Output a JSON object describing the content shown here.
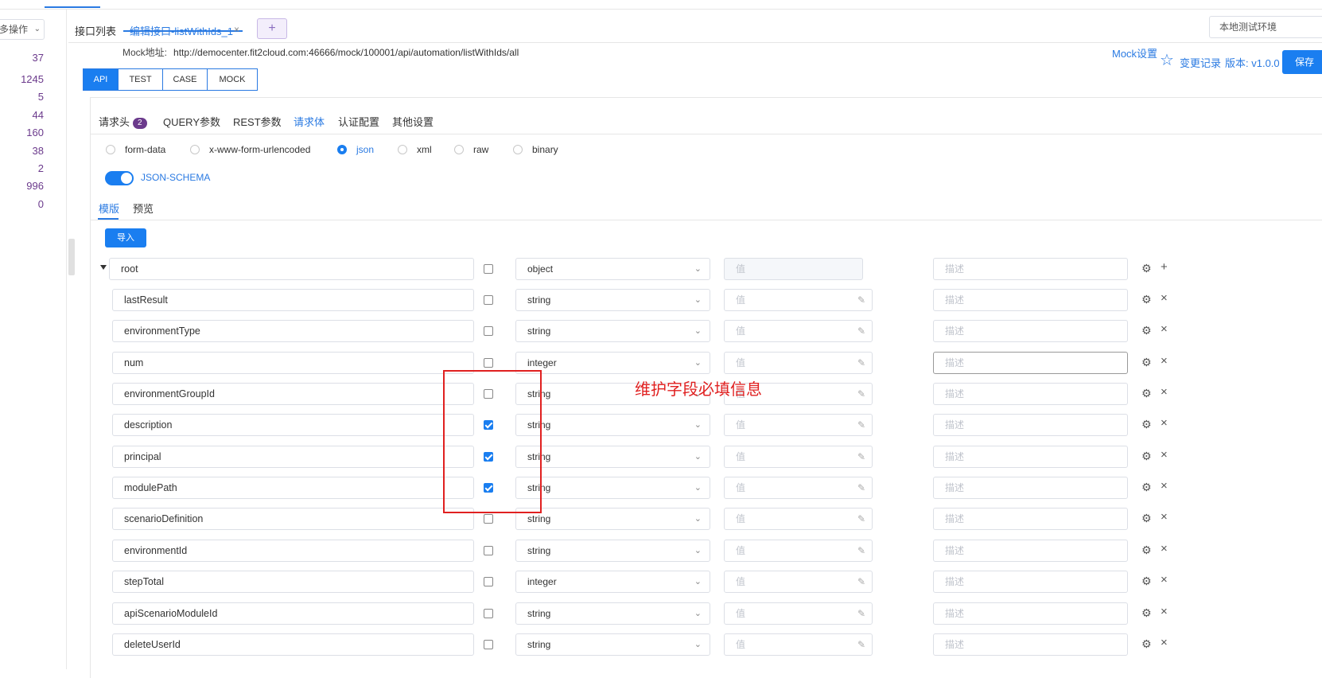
{
  "left_panel": {
    "more_ops_label": "多操作",
    "counts": [
      "37",
      "1245",
      "5",
      "44",
      "160",
      "38",
      "2",
      "996",
      "0"
    ]
  },
  "tabs": {
    "list_tab": "接口列表",
    "edit_tab": "编辑接口-listWithIds_1",
    "close_glyph": "×",
    "add_glyph": "+"
  },
  "env_select": {
    "value": "本地测试环境"
  },
  "mock": {
    "label": "Mock地址:",
    "url": "http://democenter.fit2cloud.com:46666/mock/100001/api/automation/listWithIds/all",
    "settings_link": "Mock设置"
  },
  "header_actions": {
    "change_log": "变更记录",
    "version": "版本: v1.0.0",
    "save": "保存"
  },
  "mode_tabs": [
    "API",
    "TEST",
    "CASE",
    "MOCK"
  ],
  "request_tabs": {
    "headers": "请求头",
    "headers_badge": "2",
    "query": "QUERY参数",
    "rest": "REST参数",
    "body": "请求体",
    "auth": "认证配置",
    "other": "其他设置"
  },
  "body_types": [
    "form-data",
    "x-www-form-urlencoded",
    "json",
    "xml",
    "raw",
    "binary"
  ],
  "body_type_selected": "json",
  "json_schema_label": "JSON-SCHEMA",
  "schema_tabs": {
    "template": "模版",
    "preview": "预览"
  },
  "import_label": "导入",
  "placeholders": {
    "value": "值",
    "desc": "描述"
  },
  "schema_rows": [
    {
      "name": "root",
      "required": false,
      "type": "object"
    },
    {
      "name": "lastResult",
      "required": false,
      "type": "string"
    },
    {
      "name": "environmentType",
      "required": false,
      "type": "string"
    },
    {
      "name": "num",
      "required": false,
      "type": "integer"
    },
    {
      "name": "environmentGroupId",
      "required": false,
      "type": "string"
    },
    {
      "name": "description",
      "required": true,
      "type": "string"
    },
    {
      "name": "principal",
      "required": true,
      "type": "string"
    },
    {
      "name": "modulePath",
      "required": true,
      "type": "string"
    },
    {
      "name": "scenarioDefinition",
      "required": false,
      "type": "string"
    },
    {
      "name": "environmentId",
      "required": false,
      "type": "string"
    },
    {
      "name": "stepTotal",
      "required": false,
      "type": "integer"
    },
    {
      "name": "apiScenarioModuleId",
      "required": false,
      "type": "string"
    },
    {
      "name": "deleteUserId",
      "required": false,
      "type": "string"
    }
  ],
  "annotation": "维护字段必填信息",
  "colors": {
    "accent": "#1a7ef0",
    "annotation": "#e02020",
    "count": "#6b3a8c"
  }
}
